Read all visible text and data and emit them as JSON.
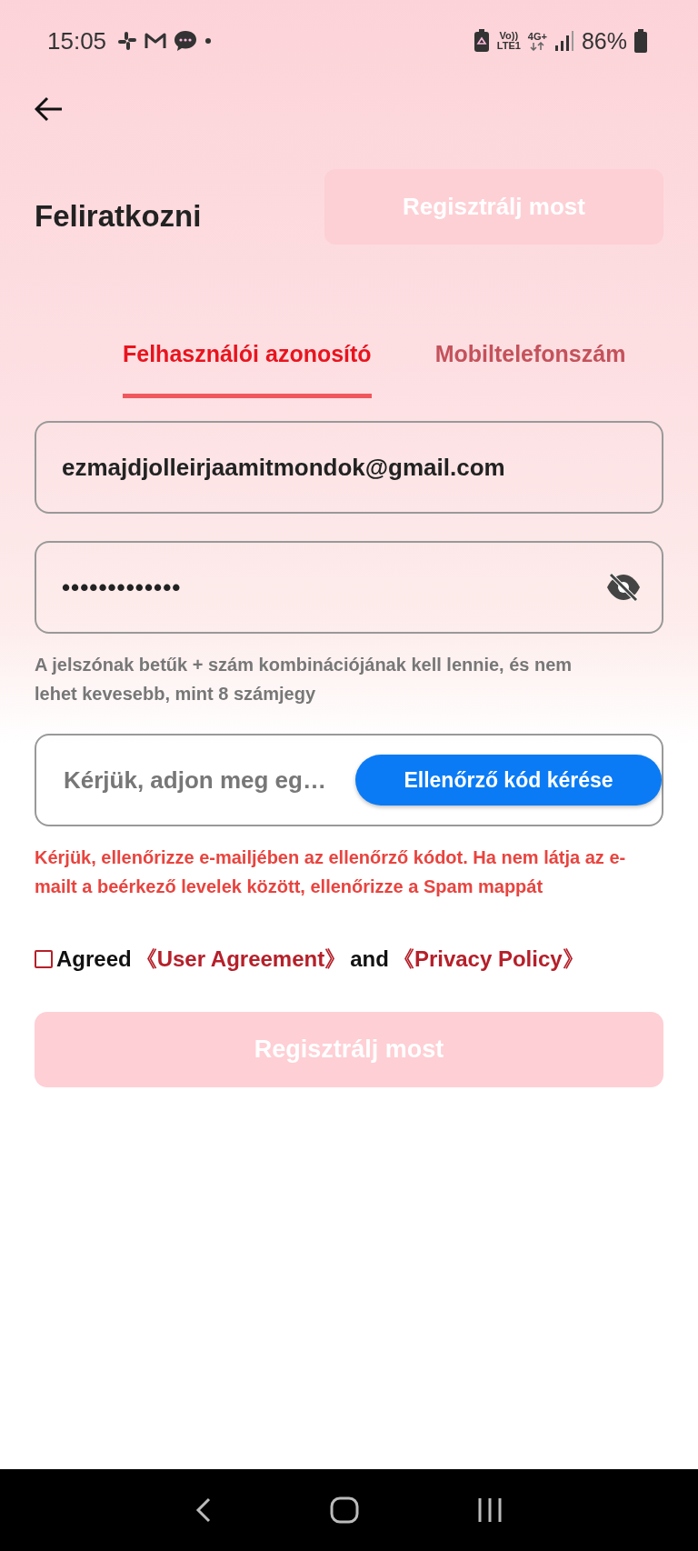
{
  "status_bar": {
    "time": "15:05",
    "volte_label": "Vo))",
    "lte_label": "LTE1",
    "network_label": "4G+",
    "battery_percent": "86%"
  },
  "header": {
    "title": "Feliratkozni",
    "top_button": {
      "label": "Regisztrálj most",
      "disabled": true
    }
  },
  "tabs": [
    {
      "label": "Felhasználói azonosító",
      "selected": true
    },
    {
      "label": "Mobiltelefonszám",
      "selected": false
    }
  ],
  "email_field": {
    "value": "ezmajdjolleirjaamitmondok@gmail.com"
  },
  "password_field": {
    "value": "•••••••••••••",
    "visible": false
  },
  "password_hint": "A jelszónak betűk + szám kombinációjának kell lennie, és nem lehet kevesebb, mint 8 számjegy",
  "code_field": {
    "placeholder": "Kérjük, adjon meg eg…",
    "button": "Ellenőrző kód kérése"
  },
  "notice": "Kérjük, ellenőrizze e-mailjében az ellenőrző kódot. Ha nem látja az e-mailt a beérkező levelek között, ellenőrizze a Spam mappát",
  "agreement": {
    "checked": false,
    "parts": [
      {
        "kind": "text",
        "text": "Agreed"
      },
      {
        "kind": "link",
        "text": "《User Agreement》"
      },
      {
        "kind": "text",
        "text": "and"
      },
      {
        "kind": "link",
        "text": "《Privacy Policy》"
      }
    ]
  },
  "submit_button": {
    "label": "Regisztrálj most",
    "disabled": true
  }
}
